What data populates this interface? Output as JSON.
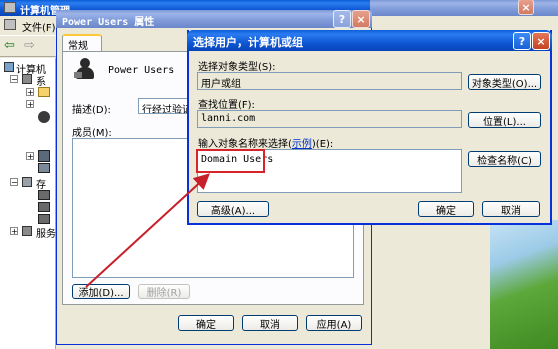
{
  "mmc": {
    "title": "计算机管理",
    "menu_file": "文件(F)",
    "tree": [
      {
        "label": "计算机"
      },
      {
        "label": "系"
      },
      {
        "label": "存"
      },
      {
        "label": "服务"
      }
    ]
  },
  "background_window": {
    "title": "Power Users 属性"
  },
  "props": {
    "title": "Power Users 属性",
    "tab_general": "常规",
    "group_name": "Power Users",
    "desc_label": "描述(D):",
    "desc_value": "行经过验证",
    "members_label": "成员(M):",
    "add_button": "添加(D)...",
    "remove_button": "删除(R)",
    "ok_button": "确定",
    "cancel_button": "取消",
    "apply_button": "应用(A)"
  },
  "select_dialog": {
    "title": "选择用户，计算机或组",
    "object_type_label": "选择对象类型(S):",
    "object_type_value": "用户或组",
    "object_type_button": "对象类型(O)...",
    "location_label": "查找位置(F):",
    "location_value": "lanni.com",
    "location_button": "位置(L)...",
    "names_label_pre": "输入对象名称来选择(",
    "names_label_link": "示例",
    "names_label_post": ")(E):",
    "names_value": "Domain Users",
    "check_names_button": "检查名称(C)",
    "advanced_button": "高级(A)...",
    "ok_button": "确定",
    "cancel_button": "取消"
  },
  "colors": {
    "title_active": "#0a5fd8",
    "dialog_face": "#ece9d8",
    "highlight_box": "#d9232a",
    "arrow": "#c8202a",
    "desktop_green": "#4f9a2a"
  }
}
